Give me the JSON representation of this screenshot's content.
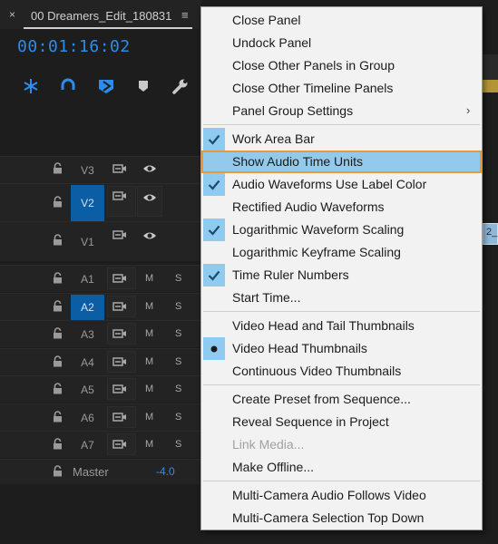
{
  "panel": {
    "close_glyph": "×",
    "title": "00 Dreamers_Edit_180831",
    "menu_glyph": "≡",
    "timecode": "00:01:16:02",
    "tools": [
      "snap-icon",
      "magnet-icon",
      "add-marker-icon",
      "marker-icon",
      "wrench-icon"
    ]
  },
  "tracks": [
    {
      "name": "V3",
      "kind": "video",
      "selected": false
    },
    {
      "name": "V2",
      "kind": "video",
      "selected": true
    },
    {
      "name": "V1",
      "kind": "video",
      "selected": false
    },
    {
      "name": "A1",
      "kind": "audio",
      "selected": false,
      "m": "M",
      "s": "S"
    },
    {
      "name": "A2",
      "kind": "audio",
      "selected": true,
      "m": "M",
      "s": "S"
    },
    {
      "name": "A3",
      "kind": "audio",
      "selected": false,
      "m": "M",
      "s": "S"
    },
    {
      "name": "A4",
      "kind": "audio",
      "selected": false,
      "m": "M",
      "s": "S"
    },
    {
      "name": "A5",
      "kind": "audio",
      "selected": false,
      "m": "M",
      "s": "S"
    },
    {
      "name": "A6",
      "kind": "audio",
      "selected": false,
      "m": "M",
      "s": "S"
    },
    {
      "name": "A7",
      "kind": "audio",
      "selected": false,
      "m": "M",
      "s": "S"
    }
  ],
  "master": {
    "label": "Master",
    "value": "-4.0"
  },
  "clip_fragment": "2_",
  "menu": {
    "items": [
      {
        "label": "Close Panel",
        "check": "none"
      },
      {
        "label": "Undock Panel",
        "check": "none"
      },
      {
        "label": "Close Other Panels in Group",
        "check": "none"
      },
      {
        "label": "Close Other Timeline Panels",
        "check": "none"
      },
      {
        "label": "Panel Group Settings",
        "check": "none",
        "submenu": true
      },
      {
        "label": "Work Area Bar",
        "check": "check"
      },
      {
        "label": "Show Audio Time Units",
        "check": "none",
        "highlight": true
      },
      {
        "label": "Audio Waveforms Use Label Color",
        "check": "check"
      },
      {
        "label": "Rectified Audio Waveforms",
        "check": "none"
      },
      {
        "label": "Logarithmic Waveform Scaling",
        "check": "check"
      },
      {
        "label": "Logarithmic Keyframe Scaling",
        "check": "none"
      },
      {
        "label": "Time Ruler Numbers",
        "check": "check"
      },
      {
        "label": "Start Time...",
        "check": "none"
      },
      {
        "label": "Video Head and Tail Thumbnails",
        "check": "none"
      },
      {
        "label": "Video Head Thumbnails",
        "check": "dot"
      },
      {
        "label": "Continuous Video Thumbnails",
        "check": "none"
      },
      {
        "label": "Create Preset from Sequence...",
        "check": "none"
      },
      {
        "label": "Reveal Sequence in Project",
        "check": "none"
      },
      {
        "label": "Link Media...",
        "check": "none",
        "disabled": true
      },
      {
        "label": "Make Offline...",
        "check": "none"
      },
      {
        "label": "Multi-Camera Audio Follows Video",
        "check": "none"
      },
      {
        "label": "Multi-Camera Selection Top Down",
        "check": "none"
      }
    ],
    "submenu_glyph": "›",
    "colors": {
      "check_bg": "#8fcbf1",
      "highlight_bg": "#93caeb",
      "highlight_border": "#e59a3a"
    }
  },
  "colors": {
    "timecode": "#2d8ceb",
    "track_selected": "#0b5da4"
  }
}
